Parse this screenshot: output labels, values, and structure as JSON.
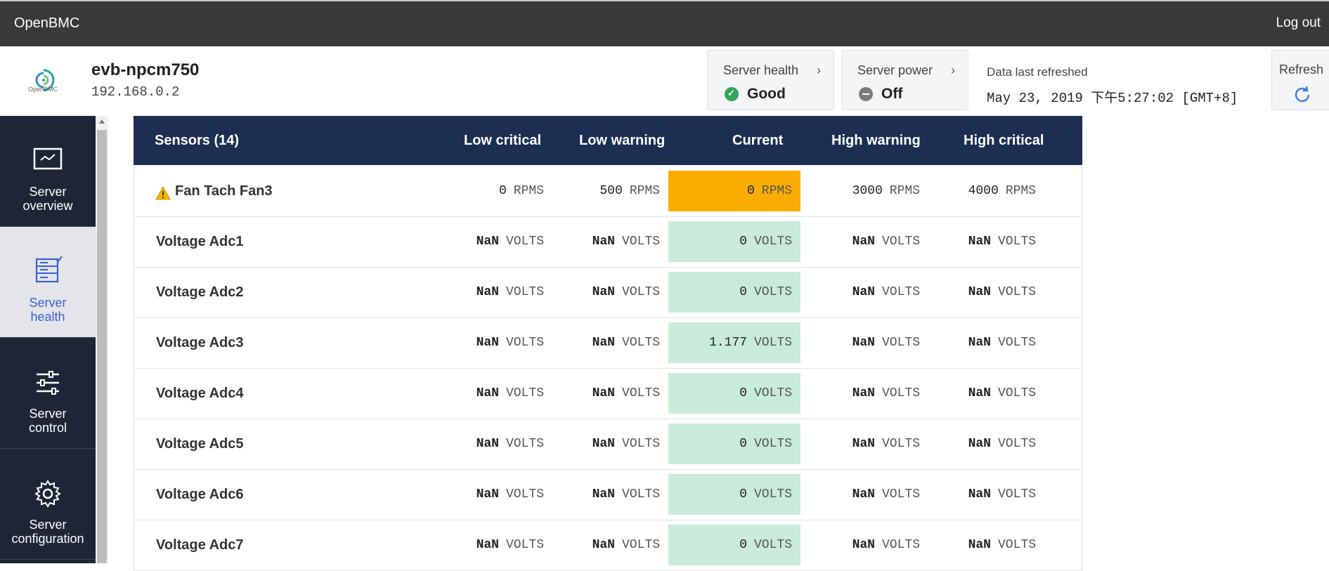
{
  "topbar": {
    "brand": "OpenBMC",
    "logout": "Log out"
  },
  "header": {
    "logo_text": "OpenBMC",
    "hostname": "evb-npcm750",
    "ip": "192.168.0.2",
    "server_health": {
      "label": "Server health",
      "value": "Good",
      "icon": "check-circle-icon",
      "color": "#2fa65a"
    },
    "server_power": {
      "label": "Server power",
      "value": "Off",
      "icon": "minus-circle-icon",
      "color": "#7b7b7b"
    },
    "refreshed_label": "Data last refreshed",
    "refreshed_value": "May 23, 2019 下午5:27:02 [GMT+8]",
    "refresh_label": "Refresh"
  },
  "sidebar": {
    "items": [
      {
        "label_1": "Server",
        "label_2": "overview",
        "icon": "monitor-icon",
        "active": false
      },
      {
        "label_1": "Server",
        "label_2": "health",
        "icon": "server-health-icon",
        "active": true
      },
      {
        "label_1": "Server",
        "label_2": "control",
        "icon": "sliders-icon",
        "active": false
      },
      {
        "label_1": "Server",
        "label_2": "configuration",
        "icon": "gear-icon",
        "active": false
      }
    ]
  },
  "table": {
    "headers": {
      "sensors": "Sensors (14)",
      "low_critical": "Low critical",
      "low_warning": "Low warning",
      "current": "Current",
      "high_warning": "High warning",
      "high_critical": "High critical"
    },
    "rows": [
      {
        "name": "Fan Tach Fan3",
        "status": "warning",
        "lc": "0",
        "lw": "500",
        "cur": "0",
        "hw": "3000",
        "hc": "4000",
        "unit": "RPMS"
      },
      {
        "name": "Voltage Adc1",
        "status": "ok",
        "lc": "NaN",
        "lw": "NaN",
        "cur": "0",
        "hw": "NaN",
        "hc": "NaN",
        "unit": "VOLTS"
      },
      {
        "name": "Voltage Adc2",
        "status": "ok",
        "lc": "NaN",
        "lw": "NaN",
        "cur": "0",
        "hw": "NaN",
        "hc": "NaN",
        "unit": "VOLTS"
      },
      {
        "name": "Voltage Adc3",
        "status": "ok",
        "lc": "NaN",
        "lw": "NaN",
        "cur": "1.177",
        "hw": "NaN",
        "hc": "NaN",
        "unit": "VOLTS"
      },
      {
        "name": "Voltage Adc4",
        "status": "ok",
        "lc": "NaN",
        "lw": "NaN",
        "cur": "0",
        "hw": "NaN",
        "hc": "NaN",
        "unit": "VOLTS"
      },
      {
        "name": "Voltage Adc5",
        "status": "ok",
        "lc": "NaN",
        "lw": "NaN",
        "cur": "0",
        "hw": "NaN",
        "hc": "NaN",
        "unit": "VOLTS"
      },
      {
        "name": "Voltage Adc6",
        "status": "ok",
        "lc": "NaN",
        "lw": "NaN",
        "cur": "0",
        "hw": "NaN",
        "hc": "NaN",
        "unit": "VOLTS"
      },
      {
        "name": "Voltage Adc7",
        "status": "ok",
        "lc": "NaN",
        "lw": "NaN",
        "cur": "0",
        "hw": "NaN",
        "hc": "NaN",
        "unit": "VOLTS"
      }
    ]
  },
  "colors": {
    "topbar": "#393939",
    "sidebar": "#1e2537",
    "table_header": "#1c2e52",
    "ok": "#c8ecd9",
    "warning": "#fbac00",
    "accent": "#3c5fd2"
  }
}
